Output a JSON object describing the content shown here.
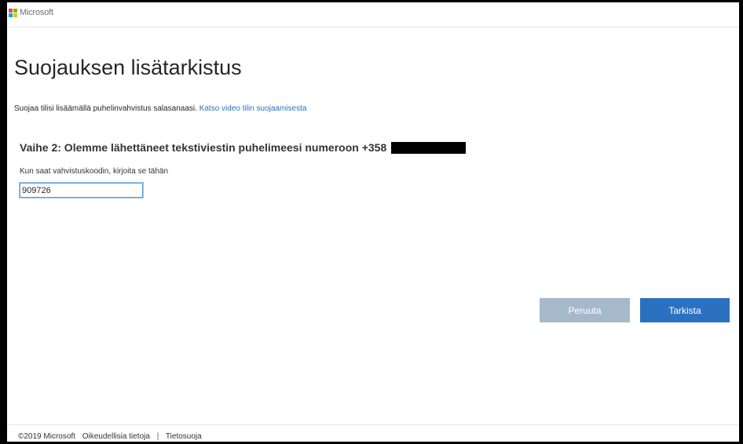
{
  "header": {
    "logo_text": "Microsoft",
    "logo_colors": [
      "#f25022",
      "#7fba00",
      "#00a4ef",
      "#ffb900"
    ]
  },
  "main": {
    "title": "Suojauksen lisätarkistus",
    "intro_text": "Suojaa tilisi lisäämällä puhelinvahvistus salasanaasi. ",
    "intro_link": "Katso video tilin suojaamisesta",
    "step_heading": "Vaihe 2: Olemme lähettäneet tekstiviestin puhelimeesi numeroon +358",
    "code_label": "Kun saat vahvistuskoodin, kirjoita se tähän",
    "code_value": "909726"
  },
  "actions": {
    "cancel_label": "Peruuta",
    "submit_label": "Tarkista"
  },
  "footer": {
    "copyright": "©2019 Microsoft",
    "legal": "Oikeudellisia tietoja",
    "separator": "|",
    "privacy": "Tietosuoja"
  },
  "colors": {
    "link": "#2672c0",
    "primary_button": "#2c71c0",
    "disabled_button": "#a6b9cb"
  }
}
